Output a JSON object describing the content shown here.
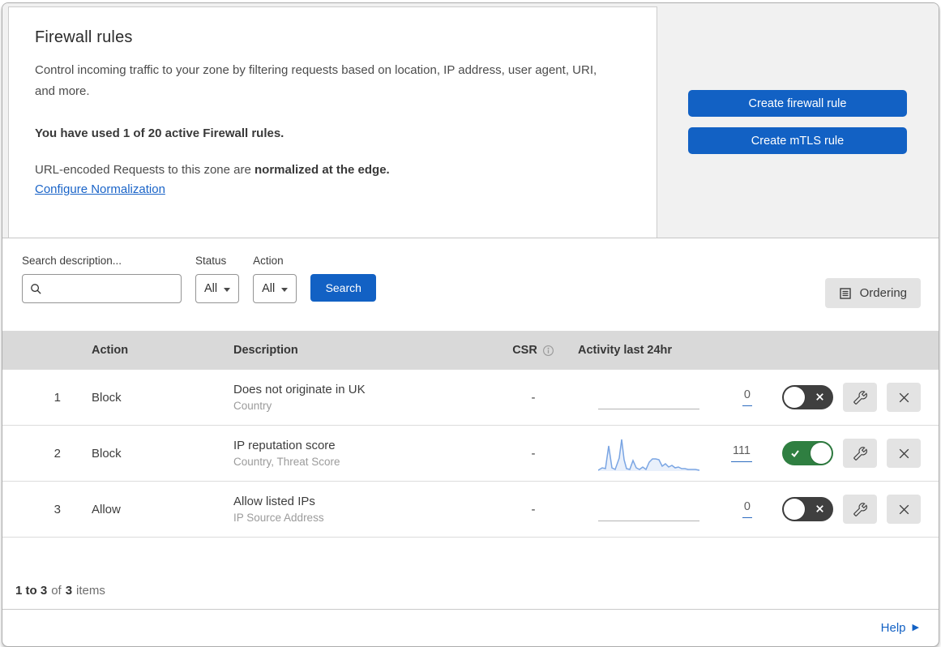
{
  "header": {
    "title": "Firewall rules",
    "description": "Control incoming traffic to your zone by filtering requests based on location, IP address, user agent, URI, and more.",
    "usage": "You have used 1 of 20 active Firewall rules.",
    "normalization_text": "URL-encoded Requests to this zone are ",
    "normalization_bold": "normalized at the edge.",
    "normalization_link": "Configure Normalization",
    "create_firewall_button": "Create firewall rule",
    "create_mtls_button": "Create mTLS rule"
  },
  "filters": {
    "search_label": "Search description...",
    "search_value": "",
    "status_label": "Status",
    "status_value": "All",
    "action_label": "Action",
    "action_value": "All",
    "search_button": "Search",
    "ordering_button": "Ordering"
  },
  "table": {
    "columns": {
      "action": "Action",
      "description": "Description",
      "csr": "CSR",
      "activity": "Activity last 24hr"
    },
    "rules": [
      {
        "priority": "1",
        "action": "Block",
        "description": "Does not originate in UK",
        "fields": "Country",
        "csr": "-",
        "activity_count": "0",
        "enabled": false
      },
      {
        "priority": "2",
        "action": "Block",
        "description": "IP reputation score",
        "fields": "Country, Threat Score",
        "csr": "-",
        "activity_count": "111",
        "enabled": true,
        "sparkline": [
          [
            0,
            43
          ],
          [
            5,
            40
          ],
          [
            9,
            41
          ],
          [
            13,
            13
          ],
          [
            17,
            40
          ],
          [
            21,
            42
          ],
          [
            26,
            28
          ],
          [
            29,
            5
          ],
          [
            32,
            30
          ],
          [
            35,
            41
          ],
          [
            39,
            42
          ],
          [
            43,
            31
          ],
          [
            47,
            40
          ],
          [
            51,
            42
          ],
          [
            55,
            39
          ],
          [
            59,
            42
          ],
          [
            63,
            33
          ],
          [
            67,
            29
          ],
          [
            71,
            29
          ],
          [
            75,
            30
          ],
          [
            79,
            38
          ],
          [
            83,
            35
          ],
          [
            87,
            39
          ],
          [
            91,
            37
          ],
          [
            95,
            40
          ],
          [
            99,
            39
          ],
          [
            103,
            41
          ],
          [
            107,
            41
          ],
          [
            111,
            42
          ],
          [
            116,
            42
          ],
          [
            120,
            42
          ],
          [
            125,
            43
          ]
        ]
      },
      {
        "priority": "3",
        "action": "Allow",
        "description": "Allow listed IPs",
        "fields": "IP Source Address",
        "csr": "-",
        "activity_count": "0",
        "enabled": false
      }
    ]
  },
  "footer": {
    "summary_start": "1 to 3",
    "summary_mid": "of",
    "summary_total": "3",
    "summary_end": "items",
    "help_label": "Help"
  },
  "icons": {
    "search": "magnifier",
    "dropdown_caret": "caret-down",
    "csr_info": "info-circle",
    "ordering": "list-document",
    "wrench": "wrench",
    "close": "x",
    "toggle_on": "check",
    "toggle_off": "x",
    "help_arrow": "▶"
  },
  "colors": {
    "primary_blue": "#1261c4",
    "link_blue": "#1a64c8",
    "toggle_on_green": "#2f7f41",
    "toggle_off_gray": "#3f3f3f",
    "sparkline_line": "#7aa5e3",
    "sparkline_fill": "#e9f0fb",
    "table_header_gray": "#d9d9d9",
    "panel_gray": "#f1f1f1"
  }
}
